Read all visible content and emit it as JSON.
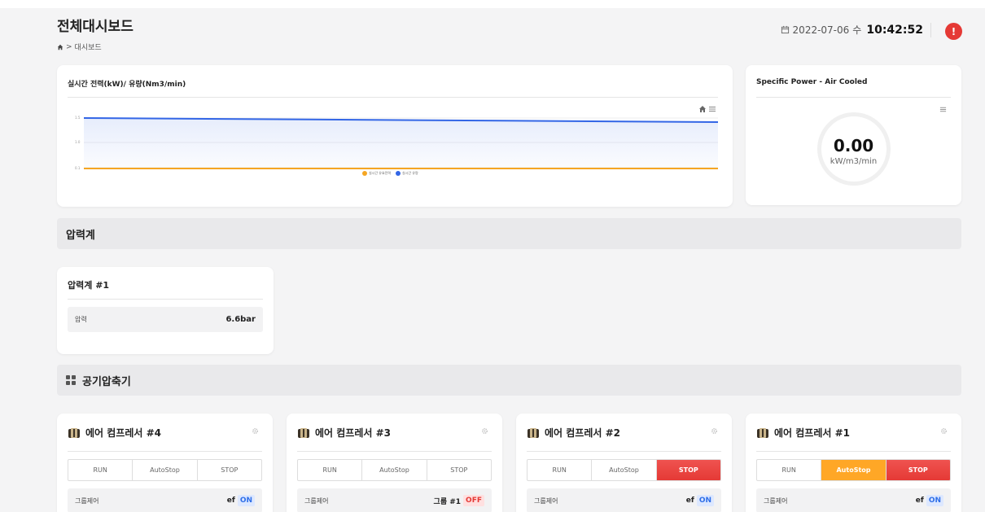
{
  "header": {
    "title": "전체대시보드",
    "breadcrumb": "대시보드",
    "date": "2022-07-06",
    "weekday": "수",
    "time": "10:42:52",
    "alert_label": "!"
  },
  "power_chart": {
    "title": "실시간 전력(kW)/ 유량(Nm3/min)",
    "legend": [
      "실시간 유효전력",
      "실시간 유량"
    ],
    "colors": {
      "power": "#f5a623",
      "flow": "#3366e6"
    }
  },
  "chart_data": {
    "type": "line",
    "title": "실시간 전력(kW)/ 유량(Nm3/min)",
    "y_ticks": [
      "1.5",
      "1.0",
      "0.1"
    ],
    "series": [
      {
        "name": "실시간 유효전력",
        "values": [
          0.1,
          0.1
        ]
      },
      {
        "name": "실시간 유량",
        "values": [
          1.5,
          1.4
        ]
      }
    ],
    "legend": "bottom-center"
  },
  "specific_power": {
    "title": "Specific Power - Air Cooled",
    "value": "0.00",
    "unit": "kW/m3/min"
  },
  "pressure_section": {
    "title": "압력계",
    "card_title": "압력계 #1",
    "label": "압력",
    "value": "6.6bar"
  },
  "compressor_section": {
    "title": "공기압축기",
    "compressors": [
      {
        "name": "에어 컴프레서 #4",
        "run": "RUN",
        "autostop": "AutoStop",
        "stop": "STOP",
        "state": "none",
        "group_label": "그룹제어",
        "group_value": "ef",
        "group_status": "ON"
      },
      {
        "name": "에어 컴프레서 #3",
        "run": "RUN",
        "autostop": "AutoStop",
        "stop": "STOP",
        "state": "none",
        "group_label": "그룹제어",
        "group_value": "그룹 #1",
        "group_status": "OFF"
      },
      {
        "name": "에어 컴프레서 #2",
        "run": "RUN",
        "autostop": "AutoStop",
        "stop": "STOP",
        "state": "stop",
        "group_label": "그룹제어",
        "group_value": "ef",
        "group_status": "ON"
      },
      {
        "name": "에어 컴프레서 #1",
        "run": "RUN",
        "autostop": "AutoStop",
        "stop": "STOP",
        "state": "autostop_stop",
        "group_label": "그룹제어",
        "group_value": "ef",
        "group_status": "ON"
      }
    ]
  }
}
